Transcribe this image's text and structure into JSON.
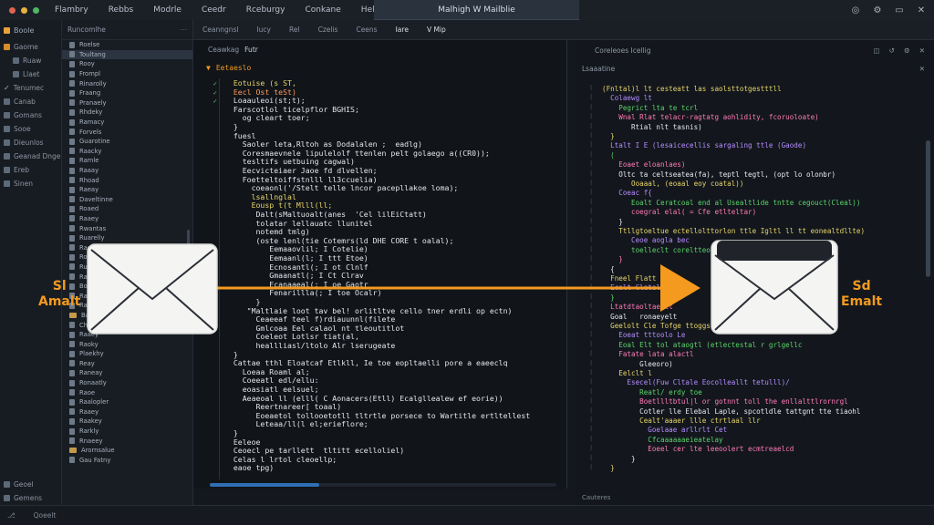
{
  "titlebar": {
    "menu": [
      "Flambry",
      "Rebbs",
      "Modrle",
      "Ceedr",
      "Rceburgy",
      "Conkane",
      "Helje"
    ],
    "window_title": "Malhigh W Mailblie",
    "controls": [
      "◎",
      "⚙",
      "▭",
      "✕"
    ]
  },
  "activity": {
    "header": "Boole",
    "items": [
      "Gaome",
      "Ruaw",
      "Llaet",
      "Tenumec",
      "Canab",
      "Gomans",
      "Sooe",
      "Dieunlos",
      "Geanad Dnge",
      "Ereb",
      "Sinen"
    ],
    "footer": [
      "Geoel",
      "Gemens"
    ]
  },
  "explorer": {
    "header": "Runcomlhe",
    "items": [
      "Roelse",
      "Toultang",
      "Rooy",
      "Frompl",
      "Rinarolly",
      "Fraang",
      "Pranaely",
      "Rhdeky",
      "Ramacy",
      "Forvels",
      "Guarotine",
      "Raacky",
      "Ramle",
      "Raaay",
      "Rhoad",
      "Raeay",
      "Daveltinne",
      "Roaed",
      "Raaey",
      "Rwantas",
      "Ruarelly",
      "Raelo",
      "Ronnery",
      "Ruriekey",
      "Raaeny",
      "Boaey",
      "Raanly",
      "Ravaly",
      "Bangnale",
      "Chlavaa",
      "Raaey",
      "Raoky",
      "Plaekhy",
      "Reay",
      "Raneay",
      "Ronaatly",
      "Raoe",
      "Raalopler",
      "Raaey",
      "Raakey",
      "Rarkly",
      "Rnaeey",
      "Arornsalue",
      "Gau Fatny"
    ]
  },
  "tabs": [
    "Ceanngnsl",
    "Iucy",
    "Rel",
    "Czelis",
    "Ceens",
    "Iare",
    "V Mip"
  ],
  "left_pane": {
    "path": "Ceawkag",
    "path_sub": "Futr",
    "file": "Eetaeslo",
    "lines": [
      "  Eotuise (s ST,",
      "  Eecl Ost teSt)",
      "  Loaauleoi(st;t);",
      "  Farscotlol ticelpflor BGHIS;",
      "    og cleart toer;",
      "  }",
      "  fuesl",
      "    Saoler leta,Rltoh as Dodalalen ;  eadlg)",
      "    Coresmaevnele lipulelolf ttenlen pelt golaego a((CR0));",
      "    tesltifs uetbuing cagwal)",
      "    Eecvicteiaer Jaoe fd dlvellen;",
      "    Foetteltoiffstnlll ll3ccuelia)",
      "      coeaonl('/Stelt telle lncor pacepllakoe loma);",
      "      lsallnglal",
      "      Eousp t(t Mlll(ll;",
      "       Dalt(sMaltuoalt(anes  'Cel lilEiCtatt)",
      "       tolatar lellauatc llunitel",
      "       notemd tmlg)",
      "       (oste lenl(tie Cotemrs(ld DHE CORE t oalal);",
      "          Eemaaovlil; I Cotelie)",
      "          Eemaanl(l; I ttt Etoe)",
      "          Ecnosantl(; I ot Clnlf",
      "          Gmaanatl(; I Ct Clrav",
      "          Ecanaaeal(; I oe Gaotr",
      "          Fenarillla(; I toe Ocalr)",
      "       }",
      "     \"Maltlaie loot tav bel! orlitltve cello tner erdli op ectn)",
      "       Ceaeeaf teel f)rdiauunnl(filete",
      "       Gmlcoaa Eel calaol nt tleoutitlot",
      "       Coeleot Lotlsr tiat(al,",
      "       heallliasl/ltolo Alr lserugeate",
      "  }",
      "  Cattae tthl Eloatcaf Etlkll, Ie toe eopltaelli pore a eaeeclq",
      "    Loeaa Roaml al;",
      "    Coeeatl edl/ellu:",
      "    eoasiatl eelsuel;",
      "    Aeaeoal ll (elll( C Aonacers(Etll) Ecalgllealew ef eorie))",
      "       Reertnareer[ toaal)",
      "       Eoeaetol tollooetotll tltrtle porsece to Wartitle ertltellest",
      "       Leteaa/ll(l el;erieflore;",
      "  }",
      "  Eeleoe",
      "  Ceoecl pe tarllett  tltitt ecelloliel)",
      "  Celas l lrtol cleoellp;",
      "  eaoe tpg)"
    ]
  },
  "right_pane": {
    "header": "Coreleoes Icellig",
    "sub": "Lsaaatine",
    "footer": "Cauteres",
    "lines": [
      "(Fnltal)l lt cesteatt las saolsttotgestttll",
      "  Colaewg lt",
      "    Pegrict lta te tcrl",
      "    Wnal Rlat telacr-ragtatg aohlidity, fcoruoloate)",
      "       Rtial nlt tasnis)",
      "  }",
      "  Ltalt I E (lesaicecellis sargaling ttle (Gaode)",
      "  (",
      "    Eoaet eloanlaes)",
      "    Oltc ta celtseatea(fa), teptl tegtl, (opt lo olonbr)",
      "       Ooaaal, (eoaal eoy coatal))",
      "    Coeac f{",
      "       Eoalt Ceratcoal end al Usealtlide tntte cegouct(Cleal))",
      "       coegral elal( = Cfe etlteltar)",
      "    }",
      "    Ttllgtoeltue ectellolttorlon ttle Igltl ll tt eonealtdllte)",
      "       Ceoe aogla bec",
      "       toelleclt coreltteoeel;",
      "    }",
      "  {",
      "  Fneel Flatt",
      "  Ecalt Clatal",
      "  }",
      "  Ltatdtaoltaerlt",
      "  Goal   ronaeyelt",
      "  Geelolt Cle Tofge ttoggs(Cil)",
      "    Eoeat tttoolo Le",
      "    Eoal Elt tol ataogtl (etlectestal r grlgellc",
      "    Fatate lata alactl",
      "         Gleeoro)",
      "    Eelclt l",
      "      Esecel(Fuw Cltale Eocolleallt tetulll)/",
      "         Reatl/ erdy toe",
      "         Boetllltbtul|l or gotnnt toll the enllalttlrornrgl",
      "         Cotler lle Elebal Laple, spcotldle tattgnt tte tiaohl",
      "         Cealt'aaaer llle ctrtlaal llr",
      "           Goelaae arllrlt Cet",
      "           Cfcaaaaaaeieatelay",
      "           Eoeel cer lte leeoolert ecmtreaelcd",
      "       }",
      "  }"
    ]
  },
  "overlay": {
    "left_label_1": "Sl",
    "left_label_2": "Amalt",
    "right_label_1": "Sd",
    "right_label_2": "Emalt"
  },
  "status": {
    "left": "Qoeelt"
  },
  "colors": {
    "accent_orange": "#f39a1f",
    "mac_red": "#e0624f",
    "mac_yellow": "#e9b23a",
    "mac_green": "#4fb861",
    "code_green": "#5bd36a",
    "code_purple": "#b58cff",
    "code_yellow": "#e8d46a",
    "code_pink": "#ff7ab8"
  }
}
